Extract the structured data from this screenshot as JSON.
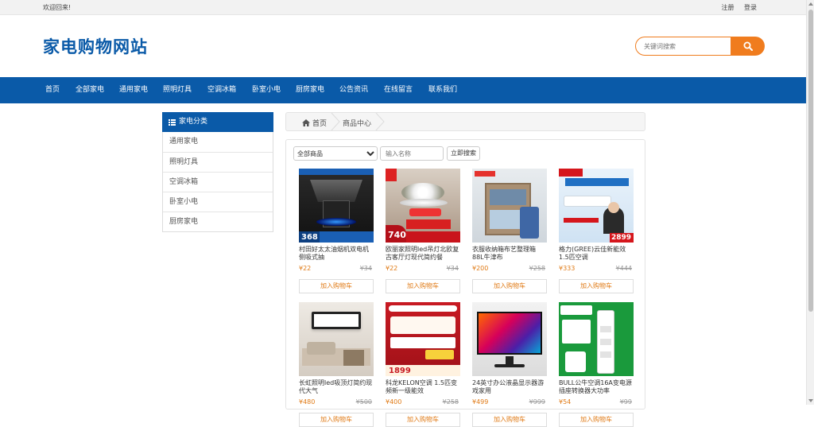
{
  "topbar": {
    "welcome": "欢迎回来!",
    "register": "注册",
    "login": "登录"
  },
  "header": {
    "logo": "家电购物网站",
    "search_placeholder": "关键词搜索"
  },
  "nav": {
    "items": [
      "首页",
      "全部家电",
      "通用家电",
      "照明灯具",
      "空调冰箱",
      "卧室小电",
      "厨房家电",
      "公告资讯",
      "在线留言",
      "联系我们"
    ]
  },
  "sidebar": {
    "title": "家电分类",
    "items": [
      "通用家电",
      "照明灯具",
      "空调冰箱",
      "卧室小电",
      "厨房家电"
    ]
  },
  "breadcrumb": {
    "home": "首页",
    "current": "商品中心"
  },
  "filter": {
    "select_value": "全部商品",
    "name_placeholder": "输入名称",
    "search_button": "立即搜索"
  },
  "products": [
    {
      "name": "村田好太太油烟机双电机侧吸式抽",
      "price": "¥22",
      "old_price": "¥34",
      "cart": "加入购物车",
      "badge": "368"
    },
    {
      "name": "欧丽家照明led吊灯北欧复古客厅灯现代简约餐",
      "price": "¥22",
      "old_price": "¥34",
      "cart": "加入购物车",
      "badge": "740"
    },
    {
      "name": "衣服收纳箱布艺整理箱88L牛津布",
      "price": "¥200",
      "old_price": "¥258",
      "cart": "加入购物车",
      "badge": ""
    },
    {
      "name": "格力(GREE)云佳新能效1.5匹空调",
      "price": "¥333",
      "old_price": "¥444",
      "cart": "加入购物车",
      "badge": "2899"
    },
    {
      "name": "长虹照明led吸顶灯简约现代大气",
      "price": "¥480",
      "old_price": "¥500",
      "cart": "加入购物车",
      "badge": ""
    },
    {
      "name": "科龙KELON空调 1.5匹变频新一级能效",
      "price": "¥400",
      "old_price": "¥258",
      "cart": "加入购物车",
      "badge": "1899"
    },
    {
      "name": "24英寸办公液晶显示器游戏家用",
      "price": "¥499",
      "old_price": "¥999",
      "cart": "加入购物车",
      "badge": ""
    },
    {
      "name": "BULL公牛空调16A变电源插座转换器大功率",
      "price": "¥54",
      "old_price": "¥99",
      "cart": "加入购物车",
      "badge": ""
    }
  ],
  "colors": {
    "brand": "#0a5aa8",
    "accent": "#f07c1e",
    "price": "#e07b17"
  }
}
